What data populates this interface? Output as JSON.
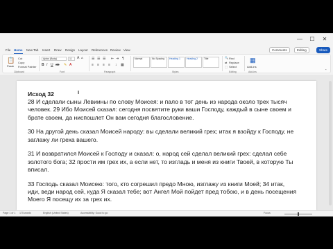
{
  "window": {
    "minimize": "—",
    "maximize": "☐",
    "close": "✕"
  },
  "tabs": [
    "File",
    "Home",
    "New Tab",
    "Insert",
    "Draw",
    "Design",
    "Layout",
    "References",
    "Review",
    "View"
  ],
  "active_tab": "Home",
  "right_buttons": {
    "comments": "Comments",
    "editing": "Editing",
    "share": "Share"
  },
  "ribbon": {
    "paste": "Paste",
    "cut": "Cut",
    "copy": "Copy",
    "format_painter": "Format Painter",
    "font_name": "Aptos (Body)",
    "font_size": "11",
    "styles": [
      "Normal",
      "No Spacing",
      "Heading 1",
      "Heading 2",
      "Title"
    ],
    "find": "Find",
    "replace": "Replace",
    "select": "Select",
    "add_in": "Add-ins",
    "groups": [
      "Clipboard",
      "Font",
      "Paragraph",
      "Styles",
      "Editing",
      "Add-ins"
    ]
  },
  "document": {
    "heading": "Исход 32",
    "paragraphs": [
      [
        "28 И сделали сыны Левиины по слову Моисея: и пало в тот день из народа около трех тысяч",
        "человек. 29 Ибо Моисей сказал: сегодня посвятите руки ваши Господу, каждый в сыне своем и",
        "брате своем, да ниспошлет Он вам сегодня благословение."
      ],
      [
        "30 На другой день сказал Моисей народу: вы сделали великий грех; итак я взойду к Господу, не",
        "заглажу ли греха вашего."
      ],
      [
        "31 И возвратился Моисей к Господу и сказал: о, народ сей сделал великий грех: сделал себе",
        "золотого бога; 32 прости им грех их, а если нет, то изгладь и меня из книги Твоей, в которую Ты",
        "вписал."
      ],
      [
        "33 Господь сказал Моисею: того, кто согрешил предо Мною, изглажу из книги Моей; 34 итак,",
        "иди, веди народ сей, куда Я сказал тебе; вот Ангел Мой пойдет пред тобою, и в день посещения",
        "Моего Я посещу их за грех их."
      ]
    ]
  },
  "status": {
    "page": "Page 1 of 1",
    "words": "175 words",
    "language": "English (United States)",
    "accessibility": "Accessibility: Good to go",
    "focus": "Focus",
    "zoom_percent": 100
  }
}
